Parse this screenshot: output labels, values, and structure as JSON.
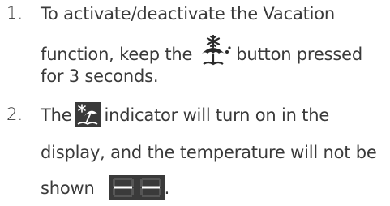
{
  "steps": [
    {
      "number": "1.",
      "line1": "To activate/deactivate the Vacation",
      "line2_before": "function, keep the",
      "line2_after": "button pressed",
      "line3": "for 3 seconds."
    },
    {
      "number": "2.",
      "line1_before": "The",
      "line1_after": "indicator will turn on in the",
      "line2": "display, and the temperature will not be",
      "line3_before": "shown",
      "line3_after": "."
    }
  ],
  "icons": {
    "vacation_button": "vacation-umbrella-snowflake-icon",
    "vacation_indicator": "vacation-indicator-icon",
    "display_dashes": "segment-display-dash-icon"
  },
  "colors": {
    "text": "#3a3a3a",
    "indicator_bg": "#3a3a3a",
    "display_segment": "#e8563a"
  }
}
